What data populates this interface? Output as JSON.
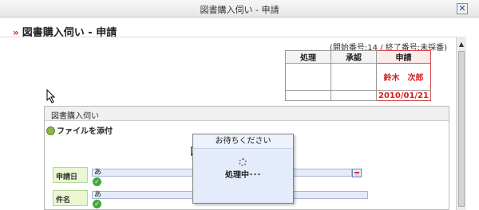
{
  "window": {
    "title": "図書購入伺い - 申請",
    "close_glyph": "✕"
  },
  "page": {
    "heading": "図書購入伺い - 申請",
    "chevron": "»"
  },
  "approval": {
    "number_text": "(開始番号:14 / 終了番号:未採番)",
    "columns": [
      "処理",
      "承認",
      "申請"
    ],
    "applicant": "鈴木　次郎",
    "date": "2010/01/21"
  },
  "panel": {
    "header": "図書購入伺い",
    "attach_label": "ファイルを添付",
    "form_title_partial": "図",
    "fields": [
      {
        "label": "申請日",
        "value": "あ"
      },
      {
        "label": "件名",
        "value": "あ"
      }
    ]
  },
  "dialog": {
    "title": "お待ちください",
    "message": "処理中･･･"
  },
  "colors": {
    "accent_red": "#d41f1f",
    "label_bg": "#eaf7d2",
    "input_bg": "#e6ebfa",
    "dialog_bg": "#e4ebfb"
  },
  "icons": [
    "close-icon",
    "chevron-icon",
    "paperclip-icon",
    "check-icon",
    "calendar-icon",
    "spinner-icon",
    "cursor-icon"
  ]
}
